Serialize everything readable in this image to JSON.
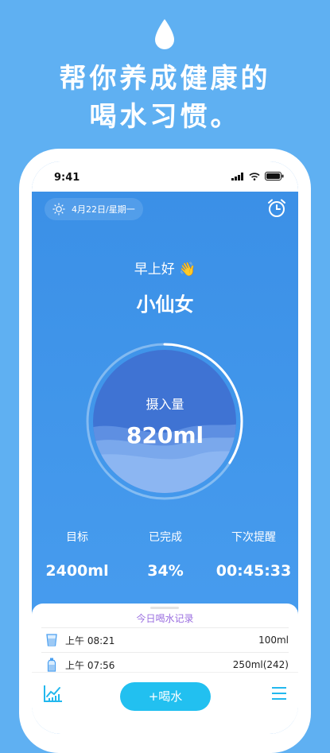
{
  "promo": {
    "headline_line1": "帮你养成健康的",
    "headline_line2": "喝水习惯。",
    "icon": "water-drop-icon"
  },
  "status_bar": {
    "time": "9:41",
    "icons": [
      "signal-icon",
      "wifi-icon",
      "battery-icon"
    ]
  },
  "header": {
    "date": "4月22日/星期一",
    "weather_icon": "sun-icon",
    "alarm_icon": "alarm-clock-icon"
  },
  "greeting": {
    "text": "早上好",
    "emoji": "👋",
    "name": "小仙女"
  },
  "intake": {
    "label": "摄入量",
    "value": "820ml",
    "progress": 0.34
  },
  "stats": [
    {
      "label": "目标",
      "value": "2400ml"
    },
    {
      "label": "已完成",
      "value": "34%"
    },
    {
      "label": "下次提醒",
      "value": "00:45:33"
    }
  ],
  "records": {
    "title": "今日喝水记录",
    "items": [
      {
        "icon": "cup-icon",
        "time": "上午 08:21",
        "amount": "100ml"
      },
      {
        "icon": "bottle-icon",
        "time": "上午 07:56",
        "amount": "250ml(242)"
      }
    ]
  },
  "bottom_bar": {
    "stats_icon": "chart-icon",
    "drink_button": "+喝水",
    "menu_icon": "menu-icon"
  },
  "colors": {
    "background": "#5fb0f2",
    "screen_top": "#3a8fe6",
    "accent_button": "#22c0f0",
    "records_title": "#9b6fe0"
  }
}
